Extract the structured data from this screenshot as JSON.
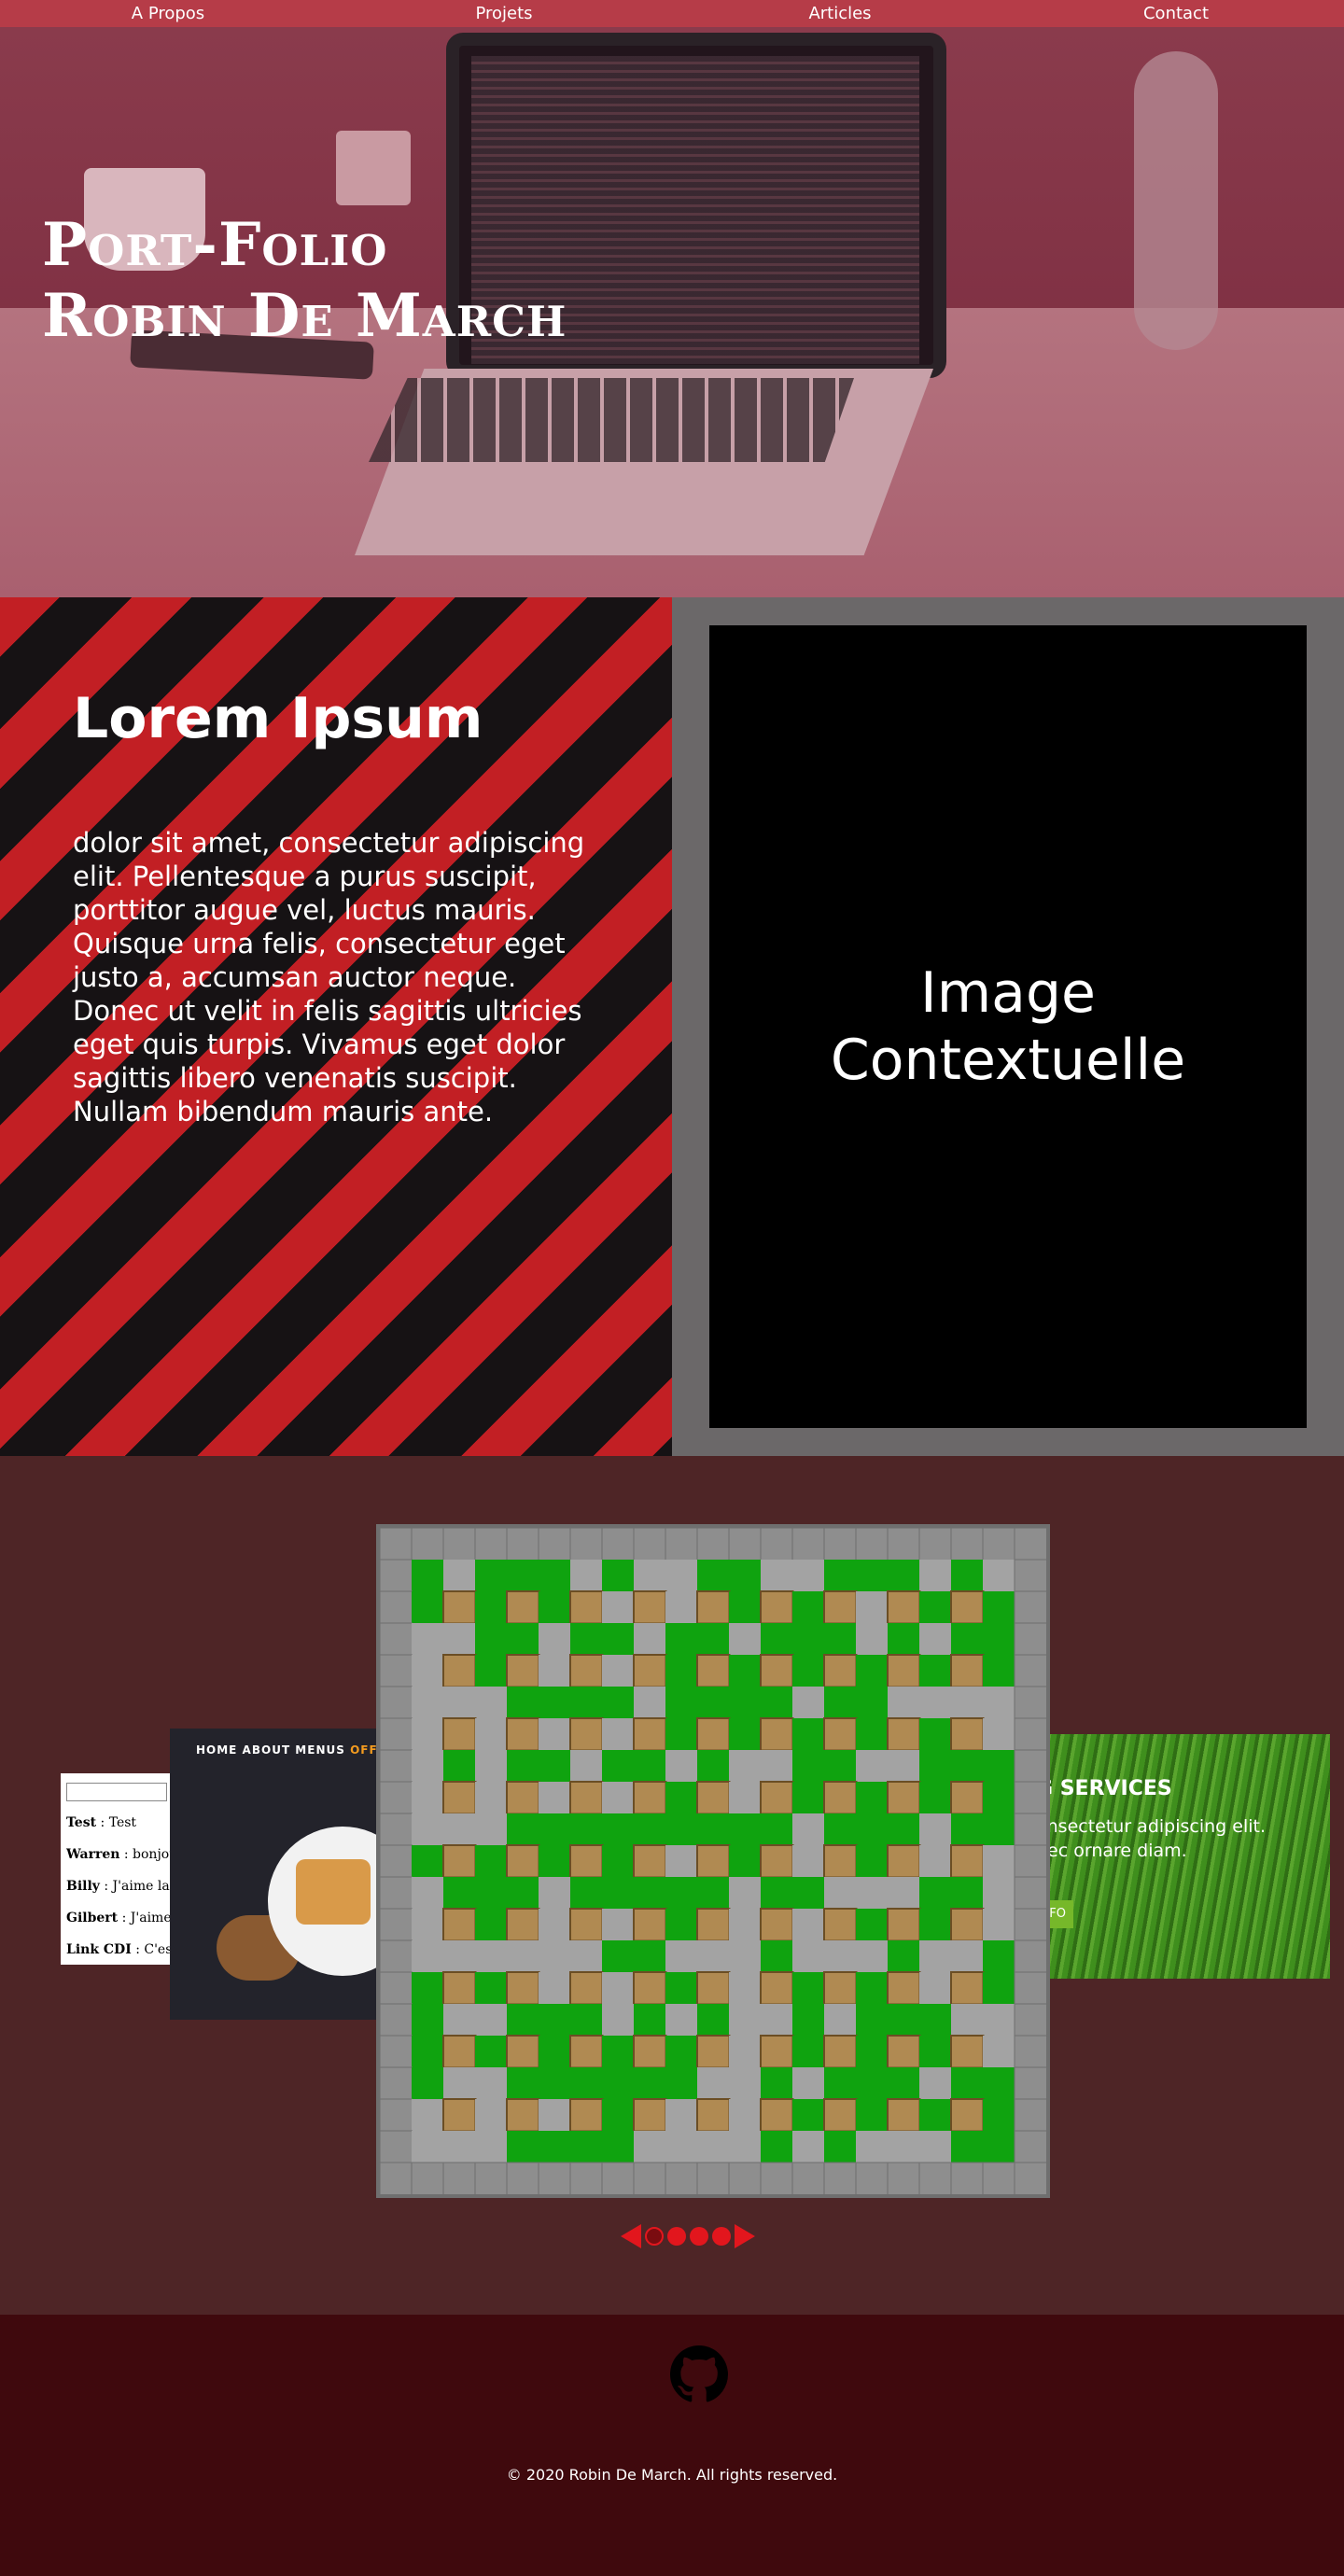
{
  "nav": {
    "items": [
      "A Propos",
      "Projets",
      "Articles",
      "Contact"
    ]
  },
  "hero": {
    "title_line1": "Port-Folio",
    "title_line2": "Robin De March"
  },
  "intro": {
    "title": "Lorem Ipsum",
    "body": " dolor sit amet, consectetur adipiscing elit. Pellentesque a purus suscipit, porttitor augue vel, luctus mauris. Quisque urna felis, consectetur eget justo a, accumsan auctor neque. Donec ut velit in felis sagittis ultricies eget quis turpis. Vivamus eget dolor sagittis libero venenatis suscipit. Nullam bibendum mauris ante.",
    "image_placeholder": "Image\nContextuelle"
  },
  "carousel": {
    "chat": {
      "messages": [
        {
          "user": "Test",
          "text": " : Test"
        },
        {
          "user": "Warren",
          "text": " : bonjour"
        },
        {
          "user": "Billy",
          "text": " : J'aime la v"
        },
        {
          "user": "Gilbert",
          "text": " : J'aime l"
        },
        {
          "user": "Link CDI",
          "text": " : C'est"
        }
      ]
    },
    "food": {
      "menu_plain": "HOME ABOUT MENUS ",
      "menu_accent": "OFFERS",
      "accent_color": "#f39b1f"
    },
    "green": {
      "title": "G SERVICES",
      "subtitle": "onsectetur adipiscing elit.\nnec ornare diam.",
      "button": "FO"
    },
    "pagination": {
      "count": 4,
      "active_index": 0,
      "prev_icon": "triangle-left-icon",
      "next_icon": "triangle-right-icon",
      "color": "#e2161d"
    }
  },
  "footer": {
    "icon": "github-icon",
    "copyright": "© 2020 Robin De March.  All rights reserved."
  },
  "colors": {
    "nav": "#b63c48",
    "stripe_red": "#c21f24",
    "stripe_dark": "#161214",
    "carousel_bg": "#4e2526",
    "footer_bg": "#3f090d"
  }
}
